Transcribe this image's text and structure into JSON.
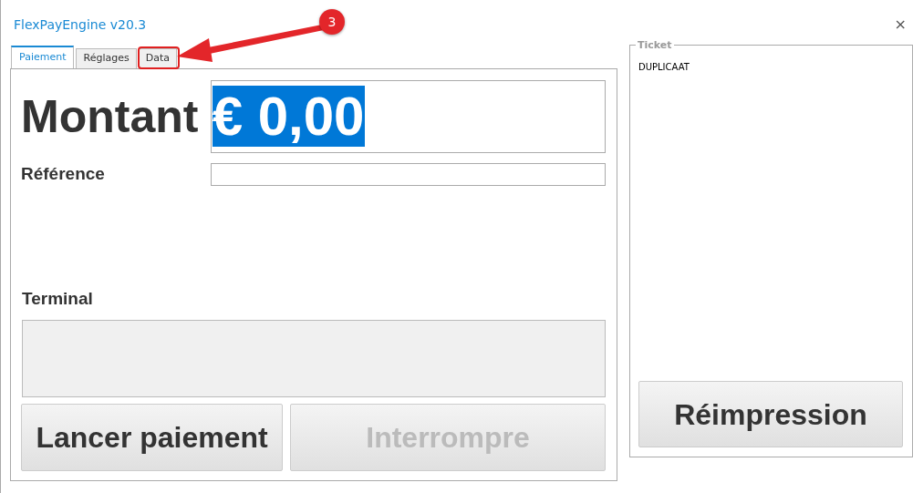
{
  "window": {
    "title": "FlexPayEngine v20.3",
    "close": "×"
  },
  "tabs": [
    {
      "label": "Paiement",
      "selected": true,
      "highlighted": false
    },
    {
      "label": "Réglages",
      "selected": false,
      "highlighted": false
    },
    {
      "label": "Data",
      "selected": false,
      "highlighted": true
    }
  ],
  "payment": {
    "amount_label": "Montant",
    "amount_value": "€ 0,00",
    "amount_selected": true,
    "reference_label": "Référence",
    "terminal_label": "Terminal"
  },
  "buttons": [
    {
      "label": "Lancer paiement",
      "disabled": false
    },
    {
      "label": "Interrompre",
      "disabled": true
    }
  ],
  "ticket": {
    "legend": "Ticket",
    "lines": [
      "DUPLICAAT"
    ],
    "button": {
      "label": "Réimpression",
      "disabled": false
    }
  },
  "annotation": {
    "badge": "3"
  }
}
